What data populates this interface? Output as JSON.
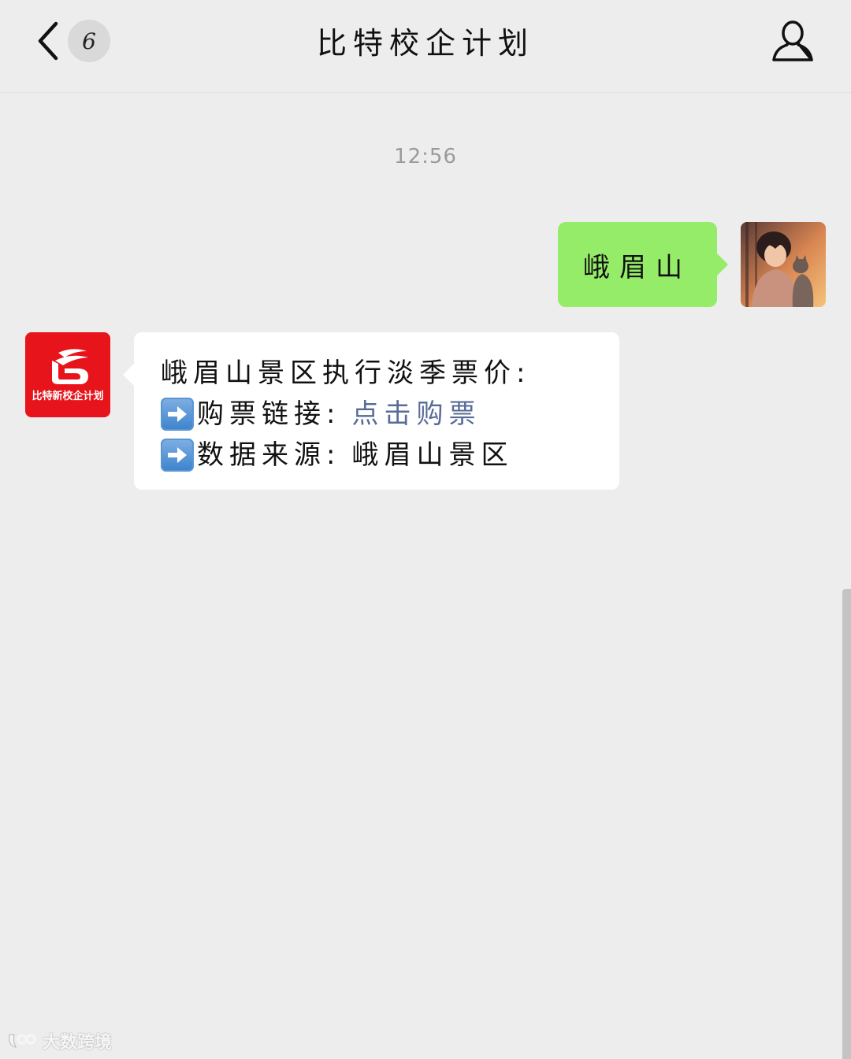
{
  "header": {
    "title": "比特校企计划",
    "unread_count": "6",
    "back_icon": "chevron-left-icon",
    "profile_icon": "person-icon"
  },
  "chat": {
    "timestamp": "12:56",
    "outgoing": {
      "text": "峨眉山",
      "bubble_color": "#95ec69"
    },
    "incoming": {
      "sender_logo_label": "比特新校企计划",
      "sender_logo_color": "#e8141b",
      "line1": "峨眉山景区执行淡季票价:",
      "line2_label": "购票链接:",
      "line2_link": "点击购票",
      "line3_label": "数据来源:",
      "line3_value": "峨眉山景区",
      "link_color": "#576b95"
    }
  },
  "watermark": {
    "text": "大数跨境"
  }
}
